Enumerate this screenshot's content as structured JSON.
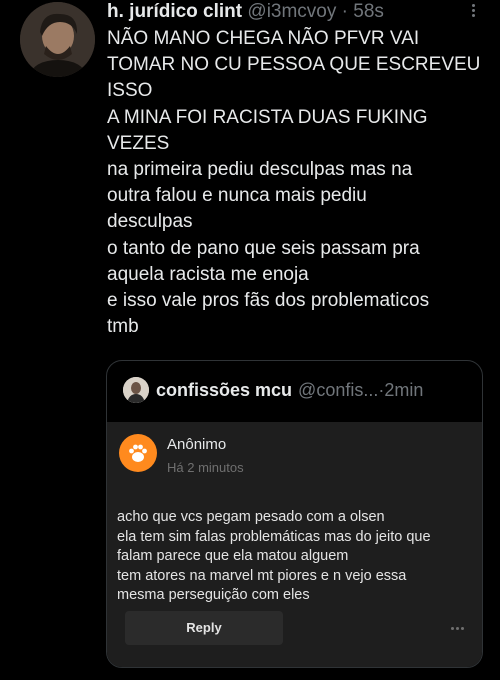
{
  "tweet": {
    "author_name": "h. jurídico clint",
    "author_handle": "@i3mcvoy",
    "separator": " · ",
    "time": "58s",
    "text_lines": [
      "NÃO MANO CHEGA NÃO PFVR VAI",
      "TOMAR NO CU PESSOA QUE ESCREVEU",
      "ISSO",
      "A MINA FOI RACISTA DUAS FUKING",
      "VEZES",
      "na primeira pediu desculpas mas na",
      "outra falou e nunca mais pediu",
      "desculpas",
      "o tanto de pano que seis passam pra",
      "aquela racista me enoja",
      "e isso vale pros fãs dos problematicos",
      "tmb"
    ]
  },
  "quote": {
    "author_name": "confissões mcu",
    "author_handle": "@confis...",
    "separator": " · ",
    "time": "2min",
    "card": {
      "sender": "Anônimo",
      "time": "Há 2 minutos",
      "body_lines": [
        "acho que vcs pegam pesado com a olsen",
        "ela tem sim falas problemáticas mas do jeito que",
        "falam parece que ela matou alguem",
        "tem atores na marvel mt piores e n vejo essa",
        "mesma perseguição com eles"
      ],
      "reply_label": "Reply",
      "icon": "paw-icon",
      "accent_color": "#ff8a1e"
    }
  },
  "colors": {
    "background": "#000000",
    "text": "#e7e9ea",
    "secondary": "#71767b",
    "card_background": "#1e1e1e"
  }
}
